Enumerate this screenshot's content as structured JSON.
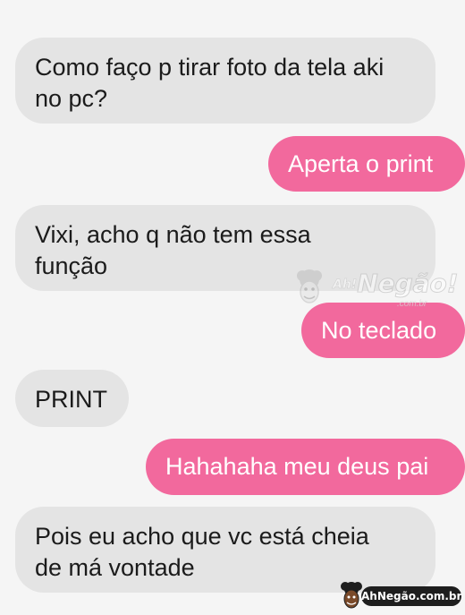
{
  "messages": [
    {
      "side": "received",
      "text": "Como faço p tirar foto da tela aki\nno pc?"
    },
    {
      "side": "sent",
      "text": "Aperta o print"
    },
    {
      "side": "received",
      "text": "Vixi, acho q não tem essa\nfunção"
    },
    {
      "side": "sent",
      "text": "No teclado"
    },
    {
      "side": "received",
      "text": "PRINT"
    },
    {
      "side": "sent",
      "text": "Hahahaha meu deus pai"
    },
    {
      "side": "received",
      "text": "Pois eu acho que vc está cheia\nde má vontade"
    }
  ],
  "watermark": {
    "prefix": "Ah!",
    "name": "Negão!",
    "domain": ".com.br",
    "badge_text": "AhNegão.com.br",
    "icon": "cartoon-face-icon"
  },
  "colors": {
    "background": "#f5f5f5",
    "received_bubble": "#e4e4e4",
    "sent_bubble": "#f2699d",
    "received_text": "#1b1b1b",
    "sent_text": "#ffffff"
  }
}
